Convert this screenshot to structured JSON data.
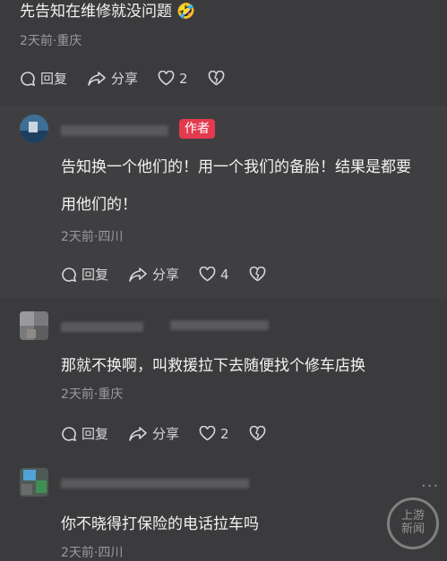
{
  "comment_top": {
    "text": "先告知在维修就没问题",
    "emoji": "🤣",
    "meta": "2天前·重庆",
    "reply_label": "回复",
    "share_label": "分享",
    "like_count": "2"
  },
  "reply1": {
    "badge": "作者",
    "text_line1": "告知换一个他们的！用一个我们的备胎！结果是都要",
    "text_line2": "用他们的！",
    "meta": "2天前·四川",
    "reply_label": "回复",
    "share_label": "分享",
    "like_count": "4"
  },
  "reply2": {
    "text": "那就不换啊，叫救援拉下去随便找个修车店换",
    "meta": "2天前·重庆",
    "reply_label": "回复",
    "share_label": "分享",
    "like_count": "2"
  },
  "reply3": {
    "text": "你不晓得打保险的电话拉车吗",
    "meta": "2天前·四川",
    "more": "···"
  },
  "watermark": {
    "line1": "上游",
    "line2": "新闻"
  },
  "colors": {
    "background": "#3b3b3d",
    "author_badge": "#e23a4f",
    "meta_text": "#9a9a9c"
  }
}
